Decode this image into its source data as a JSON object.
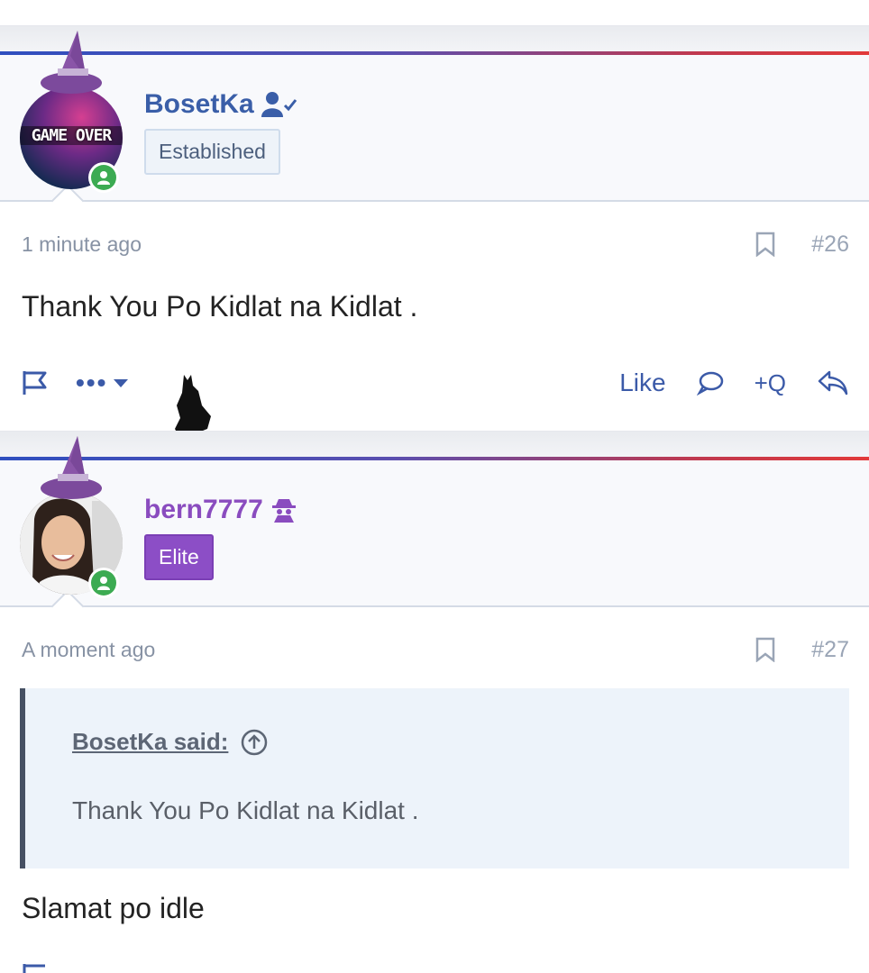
{
  "posts": [
    {
      "username": "BosetKa",
      "badge": "Established",
      "avatar_text": "GAME OVER",
      "time": "1 minute ago",
      "post_number": "#26",
      "body": "Thank You Po Kidlat na Kidlat .",
      "actions": {
        "like": "Like",
        "quote": "+Q"
      }
    },
    {
      "username": "bern7777",
      "badge": "Elite",
      "time": "A moment ago",
      "post_number": "#27",
      "quote": {
        "author": "BosetKa said:",
        "text": "Thank You Po Kidlat na Kidlat ."
      },
      "body": "Slamat po idle"
    }
  ],
  "icons": {
    "verified": "user-check-icon",
    "staff": "spy-icon",
    "bookmark": "bookmark-icon",
    "report": "flag-icon",
    "more": "ellipsis-icon",
    "reply": "reply-icon",
    "comment": "comment-icon"
  },
  "colors": {
    "link": "#3b5aa8",
    "elite": "#8c4ec6",
    "online": "#3cab52"
  }
}
